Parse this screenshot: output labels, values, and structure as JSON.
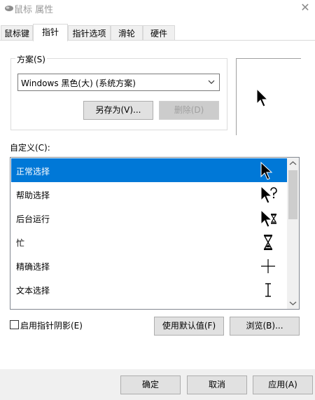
{
  "window": {
    "title": "鼠标 属性",
    "close_glyph": "✕"
  },
  "tabs": [
    {
      "label": "鼠标键"
    },
    {
      "label": "指针"
    },
    {
      "label": "指针选项"
    },
    {
      "label": "滑轮"
    },
    {
      "label": "硬件"
    }
  ],
  "active_tab_index": 1,
  "scheme": {
    "group_label": "方案(S)",
    "selected_value": "Windows 黑色(大) (系统方案)",
    "save_as_label": "另存为(V)...",
    "delete_label": "删除(D)"
  },
  "customize": {
    "label": "自定义(C):",
    "items": [
      {
        "label": "正常选择",
        "icon": "arrow-cursor-icon",
        "selected": true
      },
      {
        "label": "帮助选择",
        "icon": "help-cursor-icon"
      },
      {
        "label": "后台运行",
        "icon": "working-in-background-cursor-icon"
      },
      {
        "label": "忙",
        "icon": "busy-hourglass-cursor-icon"
      },
      {
        "label": "精确选择",
        "icon": "crosshair-cursor-icon"
      },
      {
        "label": "文本选择",
        "icon": "text-beam-cursor-icon"
      }
    ]
  },
  "shadow_checkbox": {
    "label": "启用指针阴影(E)",
    "checked": false
  },
  "buttons": {
    "use_default": "使用默认值(F)",
    "browse": "浏览(B)...",
    "ok": "确定",
    "cancel": "取消",
    "apply": "应用(A)"
  },
  "colors": {
    "selection": "#0078d7",
    "button_face": "#e1e1e1",
    "footer": "#f0f0f0"
  }
}
